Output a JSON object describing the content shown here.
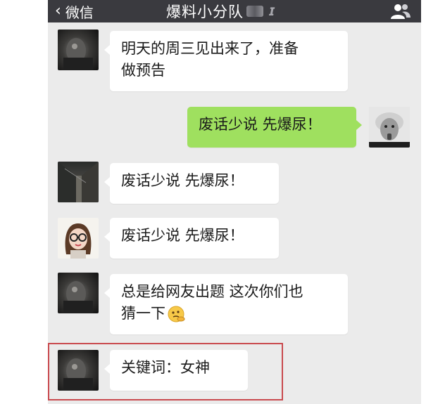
{
  "topbar": {
    "back_label": "微信",
    "chat_title": "爆料小分队"
  },
  "messages": [
    {
      "side": "left",
      "avatar": "dark-photo",
      "lines": [
        "明天的周三见出来了，准备",
        "做预告"
      ]
    },
    {
      "side": "right",
      "avatar": "einstein",
      "lines": [
        "废话少说 先爆尿！"
      ]
    },
    {
      "side": "left",
      "avatar": "alley-photo",
      "lines": [
        "废话少说 先爆尿！"
      ]
    },
    {
      "side": "left",
      "avatar": "glasses-girl",
      "lines": [
        "废话少说 先爆尿！"
      ]
    },
    {
      "side": "left",
      "avatar": "dark-photo",
      "lines": [
        "总是给网友出题 这次你们也",
        "猜一下"
      ],
      "emoji": "thinking-face"
    },
    {
      "side": "left",
      "avatar": "dark-photo",
      "lines": [
        "关键词：女神"
      ],
      "highlighted": true
    }
  ],
  "colors": {
    "topbar": "#3a3a3f",
    "chat_background": "#ebebeb",
    "sent_bubble": "#9fe05f",
    "received_bubble": "#ffffff",
    "highlight_border": "#c94a4e"
  }
}
